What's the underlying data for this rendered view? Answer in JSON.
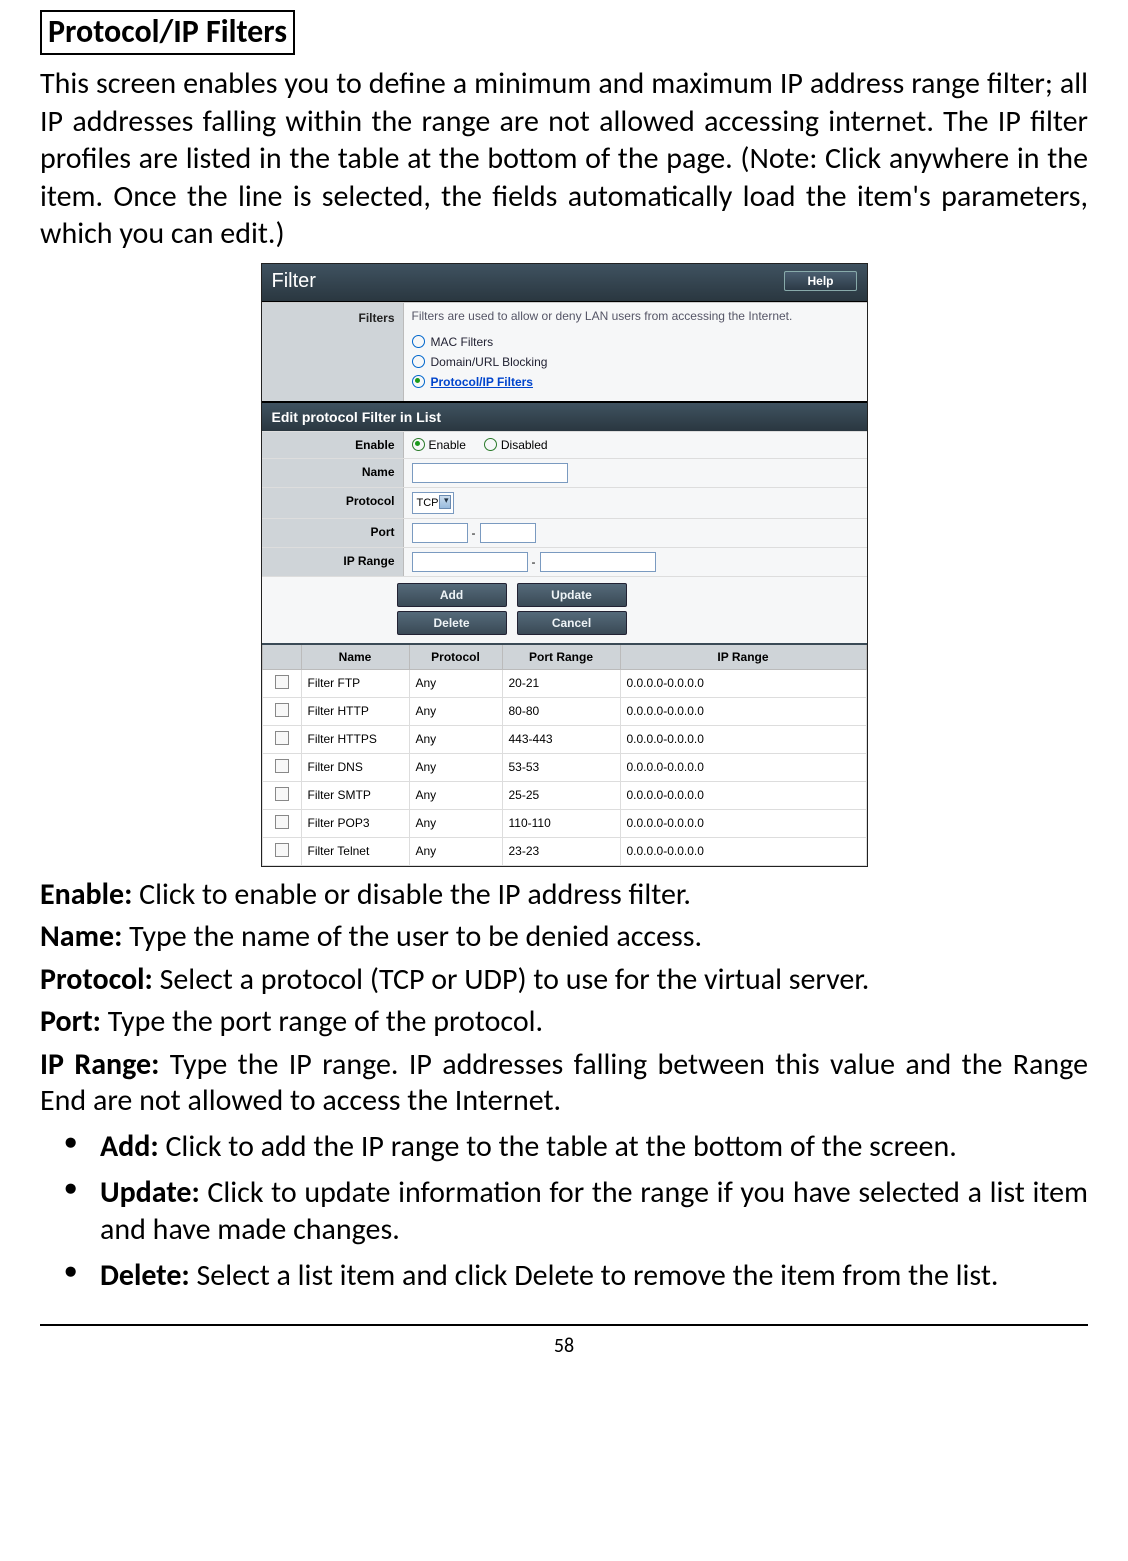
{
  "title": "Protocol/IP Filters",
  "intro_para": "This screen enables you to define a minimum and maximum IP address range filter; all IP addresses falling within the range are not allowed accessing internet. The IP filter profiles are listed in the table at the bottom of the page. (Note: Click anywhere in the item. Once the line is selected, the fields automatically load the item's parameters, which you can edit.)",
  "screenshot": {
    "header_title": "Filter",
    "help_label": "Help",
    "filters_label": "Filters",
    "filters_desc": "Filters are used to allow or deny LAN users from accessing the Internet.",
    "filter_options": {
      "mac": "MAC Filters",
      "domain": "Domain/URL Blocking",
      "protocol": "Protocol/IP Filters"
    },
    "edit_header": "Edit protocol Filter in List",
    "form": {
      "enable_label": "Enable",
      "enable_opt": "Enable",
      "disabled_opt": "Disabled",
      "name_label": "Name",
      "protocol_label": "Protocol",
      "protocol_value": "TCP",
      "port_label": "Port",
      "iprange_label": "IP Range"
    },
    "buttons": {
      "add": "Add",
      "update": "Update",
      "delete": "Delete",
      "cancel": "Cancel"
    },
    "table": {
      "headers": {
        "name": "Name",
        "protocol": "Protocol",
        "portrange": "Port Range",
        "iprange": "IP Range"
      },
      "rows": [
        {
          "name": "Filter FTP",
          "protocol": "Any",
          "portrange": "20-21",
          "iprange": "0.0.0.0-0.0.0.0"
        },
        {
          "name": "Filter HTTP",
          "protocol": "Any",
          "portrange": "80-80",
          "iprange": "0.0.0.0-0.0.0.0"
        },
        {
          "name": "Filter HTTPS",
          "protocol": "Any",
          "portrange": "443-443",
          "iprange": "0.0.0.0-0.0.0.0"
        },
        {
          "name": "Filter DNS",
          "protocol": "Any",
          "portrange": "53-53",
          "iprange": "0.0.0.0-0.0.0.0"
        },
        {
          "name": "Filter SMTP",
          "protocol": "Any",
          "portrange": "25-25",
          "iprange": "0.0.0.0-0.0.0.0"
        },
        {
          "name": "Filter POP3",
          "protocol": "Any",
          "portrange": "110-110",
          "iprange": "0.0.0.0-0.0.0.0"
        },
        {
          "name": "Filter Telnet",
          "protocol": "Any",
          "portrange": "23-23",
          "iprange": "0.0.0.0-0.0.0.0"
        }
      ]
    }
  },
  "defs": {
    "enable_l": "Enable:",
    "enable_t": " Click to enable or disable the IP address filter.",
    "name_l": "Name:",
    "name_t": " Type the name of the user to be denied access.",
    "protocol_l": "Protocol:",
    "protocol_t": " Select a protocol (TCP or UDP) to use for the virtual server.",
    "port_l": "Port:",
    "port_t": " Type the port range of the protocol.",
    "iprange_l": "IP Range:",
    "iprange_t": " Type the IP range. IP addresses falling between this value and the Range End are not allowed to access the Internet."
  },
  "bullets": {
    "add_l": "Add:",
    "add_t": " Click to add the IP range to the table at the bottom of the screen.",
    "update_l": "Update:",
    "update_t": " Click to update information for the range if you have selected a list item and have made changes.",
    "delete_l": "Delete:",
    "delete_t": " Select a list item and click Delete to remove the item from the list."
  },
  "page_number": "58"
}
